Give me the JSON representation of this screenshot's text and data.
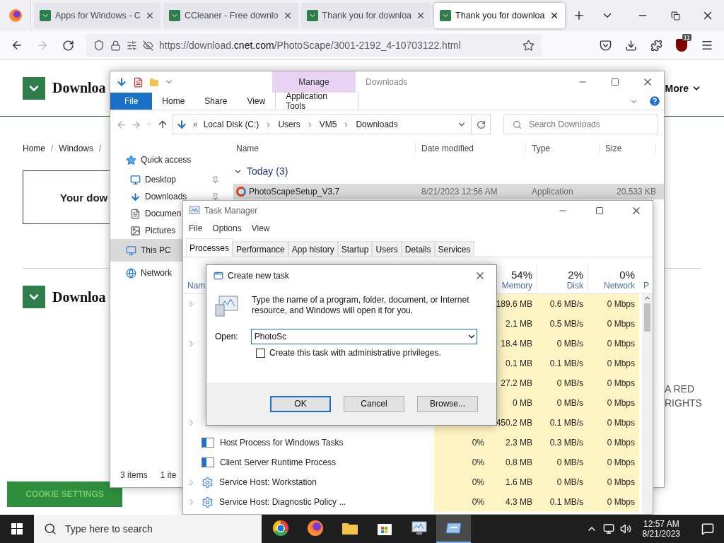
{
  "browser": {
    "tabs": [
      {
        "title": "Apps for Windows - C",
        "selected": false
      },
      {
        "title": "CCleaner - Free downlo",
        "selected": false
      },
      {
        "title": "Thank you for downloa",
        "selected": false
      },
      {
        "title": "Thank you for downloa",
        "selected": true
      }
    ],
    "url": {
      "prefix": "https://download.",
      "domain": "cnet.com",
      "path": "/PhotoScape/3001-2192_4-10703122.html"
    },
    "extension_badge": "11"
  },
  "page": {
    "logo_text": "Downloa",
    "more_label": "More",
    "breadcrumb": [
      "Home",
      "Windows"
    ],
    "breadcrumb_separator": "/",
    "banner": "Your dow",
    "section_heading": "Downloa",
    "side_text": [
      "A RED",
      "RIGHTS"
    ],
    "cookie_button": "COOKIE SETTINGS"
  },
  "explorer": {
    "context_tab": "Manage",
    "title": "Downloads",
    "ribbon_tabs": [
      {
        "label": "File",
        "kind": "file"
      },
      {
        "label": "Home",
        "kind": "tab"
      },
      {
        "label": "Share",
        "kind": "tab"
      },
      {
        "label": "View",
        "kind": "tab"
      },
      {
        "label": "Application Tools",
        "kind": "context"
      }
    ],
    "path_overflow": "«",
    "path": [
      "Local Disk (C:)",
      "Users",
      "VM5",
      "Downloads"
    ],
    "search": {
      "placeholder": "Search Downloads"
    },
    "columns": [
      "Name",
      "Date modified",
      "Type",
      "Size"
    ],
    "group": "Today (3)",
    "files": [
      {
        "name": "PhotoScapeSetup_V3.7",
        "date": "8/21/2023 12:56 AM",
        "type": "Application",
        "size": "20,533 KB",
        "selected": true
      }
    ],
    "nav": [
      {
        "label": "Quick access",
        "kind": "star",
        "selected": false,
        "children": [
          {
            "label": "Desktop",
            "kind": "desktop",
            "pinned": true,
            "selected": false
          },
          {
            "label": "Downloads",
            "kind": "download",
            "pinned": true,
            "selected": false
          },
          {
            "label": "Documen",
            "kind": "document",
            "selected": false
          },
          {
            "label": "Pictures",
            "kind": "pictures",
            "selected": false
          }
        ]
      },
      {
        "label": "This PC",
        "kind": "pc",
        "selected": true
      },
      {
        "label": "Network",
        "kind": "network",
        "selected": false
      }
    ],
    "status": [
      "3 items",
      "1 ite"
    ]
  },
  "task_manager": {
    "title": "Task Manager",
    "menu": [
      "File",
      "Options",
      "View"
    ],
    "tabs": [
      {
        "label": "Processes",
        "selected": true
      },
      {
        "label": "Performance",
        "selected": false
      },
      {
        "label": "App history",
        "selected": false
      },
      {
        "label": "Startup",
        "selected": false
      },
      {
        "label": "Users",
        "selected": false
      },
      {
        "label": "Details",
        "selected": false
      },
      {
        "label": "Services",
        "selected": false
      }
    ],
    "name_header": "Nam",
    "columns": [
      {
        "percent": "54%",
        "label": "Memory"
      },
      {
        "percent": "2%",
        "label": "Disk"
      },
      {
        "percent": "0%",
        "label": "Network"
      }
    ],
    "column_5": "P",
    "rows": [
      {
        "kind": "hidden",
        "expandable": true,
        "memory": "189.6 MB",
        "disk": "0.6 MB/s",
        "network": "0 Mbps"
      },
      {
        "kind": "hidden",
        "expandable": false,
        "memory": "2.1 MB",
        "disk": "0.5 MB/s",
        "network": "0 Mbps"
      },
      {
        "kind": "hidden",
        "expandable": true,
        "memory": "18.4 MB",
        "disk": "0 MB/s",
        "network": "0 Mbps"
      },
      {
        "kind": "hidden",
        "expandable": false,
        "memory": "0.1 MB",
        "disk": "0.1 MB/s",
        "network": "0 Mbps"
      },
      {
        "kind": "hidden",
        "expandable": false,
        "memory": "27.2 MB",
        "disk": "0 MB/s",
        "network": "0 Mbps"
      },
      {
        "kind": "hidden",
        "expandable": false,
        "memory": "0 MB",
        "disk": "0 MB/s",
        "network": "0 Mbps"
      },
      {
        "kind": "hidden",
        "expandable": true,
        "memory": "450.2 MB",
        "disk": "0.1 MB/s",
        "network": "0 Mbps"
      },
      {
        "kind": "window",
        "expandable": false,
        "name": "Host Process for Windows Tasks",
        "cpu": "0%",
        "memory": "2.3 MB",
        "disk": "0.3 MB/s",
        "network": "0 Mbps"
      },
      {
        "kind": "window",
        "expandable": false,
        "name": "Client Server Runtime Process",
        "cpu": "0%",
        "memory": "0.8 MB",
        "disk": "0 MB/s",
        "network": "0 Mbps"
      },
      {
        "kind": "gear",
        "expandable": true,
        "name": "Service Host: Workstation",
        "cpu": "0%",
        "memory": "1.6 MB",
        "disk": "0 MB/s",
        "network": "0 Mbps"
      },
      {
        "kind": "gear",
        "expandable": true,
        "name": "Service Host: Diagnostic Policy ...",
        "cpu": "0%",
        "memory": "4.3 MB",
        "disk": "0.1 MB/s",
        "network": "0 Mbps"
      }
    ]
  },
  "dialog": {
    "title": "Create new task",
    "message": "Type the name of a program, folder, document, or Internet resource, and Windows will open it for you.",
    "open_label": "Open:",
    "value": "PhotoSc",
    "admin_label": "Create this task with administrative privileges.",
    "admin_checked": false,
    "buttons": [
      {
        "label": "OK",
        "default": true
      },
      {
        "label": "Cancel",
        "default": false
      },
      {
        "label": "Browse...",
        "default": false
      }
    ]
  },
  "taskbar": {
    "search": {
      "placeholder": "Type here to search"
    },
    "apps": [
      {
        "kind": "chrome",
        "active": false
      },
      {
        "kind": "firefox",
        "active": false
      },
      {
        "kind": "folder",
        "active": false
      },
      {
        "kind": "store",
        "active": false
      },
      {
        "kind": "taskmgr",
        "active": false
      },
      {
        "kind": "run",
        "active": true
      }
    ],
    "time": "12:57 AM",
    "date": "8/21/2023"
  }
}
